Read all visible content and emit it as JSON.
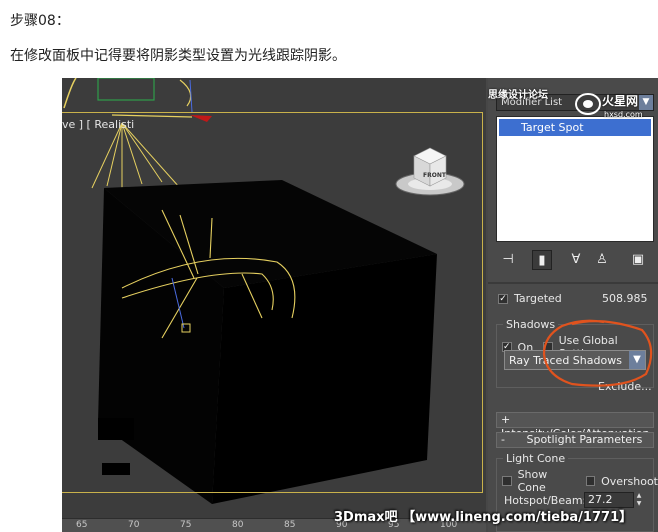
{
  "article": {
    "step_title": "步骤08：",
    "instruction": "在修改面板中记得要将阴影类型设置为光线跟踪阴影。"
  },
  "viewport": {
    "label": "ve ] [ Realisti",
    "viewcube_face": "FRONT",
    "ruler_labels": [
      "65",
      "70",
      "75",
      "80",
      "85",
      "90",
      "95",
      "100"
    ]
  },
  "panel": {
    "modifier_list_label": "Modifier List",
    "stack_items": [
      "Target Spot"
    ],
    "targeted": {
      "label": "Targeted",
      "checked": true,
      "value": "508.985"
    },
    "shadows": {
      "group_title": "Shadows",
      "on_label": "On",
      "on_checked": true,
      "use_global_label": "Use Global Settings",
      "use_global_checked": false,
      "shadow_type": "Ray Traced Shadows",
      "exclude_label": "Exclude..."
    },
    "rollouts": {
      "intensity": "Intensity/Color/Attenuation",
      "spotlight": "Spotlight Parameters"
    },
    "light_cone": {
      "group_title": "Light Cone",
      "show_cone_label": "Show Cone",
      "show_cone_checked": false,
      "overshoot_label": "Overshoot",
      "overshoot_checked": false,
      "hotspot_label": "Hotspot/Beam:",
      "hotspot_value": "27.2"
    }
  },
  "watermarks": {
    "top_text": "思缘设计论坛",
    "logo_text": "火星网",
    "logo_url": "hxsd.com",
    "bottom_text": "3Dmax吧 【www.lineng.com/tieba/1771】"
  },
  "colors": {
    "selection": "#3d6fd0",
    "callout": "#e0531e",
    "viewport_frame": "#c9b24b",
    "gizmo": "#e6d060"
  }
}
